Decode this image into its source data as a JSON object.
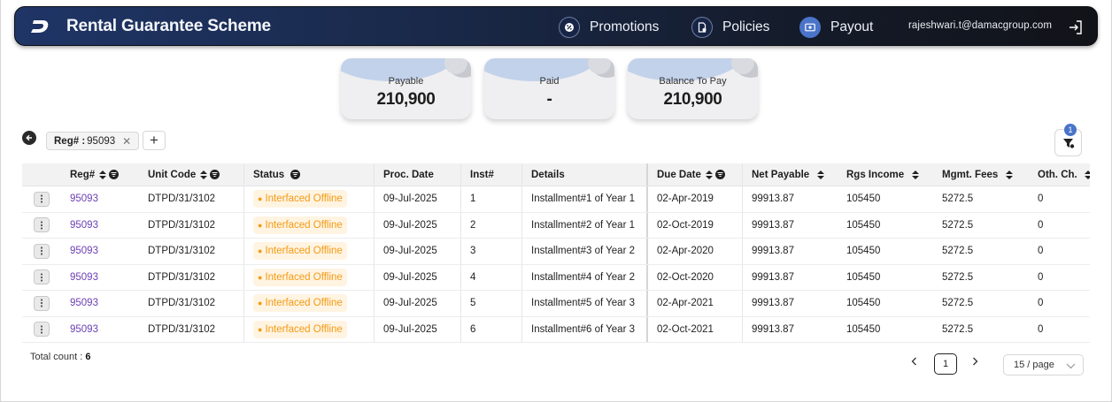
{
  "header": {
    "title": "Rental Guarantee Scheme",
    "nav": [
      {
        "label": "Promotions",
        "icon": "promotion-icon",
        "active": false
      },
      {
        "label": "Policies",
        "icon": "policy-document-icon",
        "active": false
      },
      {
        "label": "Payout",
        "icon": "payout-icon",
        "active": true
      }
    ],
    "user_email": "rajeshwari.t@damacgroup.com"
  },
  "summary": [
    {
      "label": "Payable",
      "value": "210,900"
    },
    {
      "label": "Paid",
      "value": "-"
    },
    {
      "label": "Balance To Pay",
      "value": "210,900"
    }
  ],
  "filters": {
    "chip_key": "Reg# :",
    "chip_value": "95093",
    "active_filter_count": "1"
  },
  "table": {
    "columns": [
      {
        "label": "Reg#",
        "sortable": true,
        "filterable": true
      },
      {
        "label": "Unit Code",
        "sortable": true,
        "filterable": true
      },
      {
        "label": "Status",
        "sortable": false,
        "filterable": true
      },
      {
        "label": "Proc. Date",
        "sortable": false,
        "filterable": false
      },
      {
        "label": "Inst#",
        "sortable": false,
        "filterable": false
      },
      {
        "label": "Details",
        "sortable": false,
        "filterable": false
      },
      {
        "label": "Due Date",
        "sortable": true,
        "filterable": true
      },
      {
        "label": "Net Payable",
        "sortable": true,
        "filterable": false
      },
      {
        "label": "Rgs Income",
        "sortable": true,
        "filterable": false
      },
      {
        "label": "Mgmt. Fees",
        "sortable": true,
        "filterable": false
      },
      {
        "label": "Oth. Ch.",
        "sortable": true,
        "filterable": false
      }
    ],
    "rows": [
      {
        "reg": "95093",
        "unit": "DTPD/31/3102",
        "status": "Interfaced Offline",
        "proc": "09-Jul-2025",
        "inst": "1",
        "details": "Installment#1 of Year 1",
        "due": "02-Apr-2019",
        "net": "99913.87",
        "rgs": "105450",
        "mgmt": "5272.5",
        "oth": "0"
      },
      {
        "reg": "95093",
        "unit": "DTPD/31/3102",
        "status": "Interfaced Offline",
        "proc": "09-Jul-2025",
        "inst": "2",
        "details": "Installment#2 of Year 1",
        "due": "02-Oct-2019",
        "net": "99913.87",
        "rgs": "105450",
        "mgmt": "5272.5",
        "oth": "0"
      },
      {
        "reg": "95093",
        "unit": "DTPD/31/3102",
        "status": "Interfaced Offline",
        "proc": "09-Jul-2025",
        "inst": "3",
        "details": "Installment#3 of Year 2",
        "due": "02-Apr-2020",
        "net": "99913.87",
        "rgs": "105450",
        "mgmt": "5272.5",
        "oth": "0"
      },
      {
        "reg": "95093",
        "unit": "DTPD/31/3102",
        "status": "Interfaced Offline",
        "proc": "09-Jul-2025",
        "inst": "4",
        "details": "Installment#4 of Year 2",
        "due": "02-Oct-2020",
        "net": "99913.87",
        "rgs": "105450",
        "mgmt": "5272.5",
        "oth": "0"
      },
      {
        "reg": "95093",
        "unit": "DTPD/31/3102",
        "status": "Interfaced Offline",
        "proc": "09-Jul-2025",
        "inst": "5",
        "details": "Installment#5 of Year 3",
        "due": "02-Apr-2021",
        "net": "99913.87",
        "rgs": "105450",
        "mgmt": "5272.5",
        "oth": "0"
      },
      {
        "reg": "95093",
        "unit": "DTPD/31/3102",
        "status": "Interfaced Offline",
        "proc": "09-Jul-2025",
        "inst": "6",
        "details": "Installment#6 of Year 3",
        "due": "02-Oct-2021",
        "net": "99913.87",
        "rgs": "105450",
        "mgmt": "5272.5",
        "oth": "0"
      }
    ]
  },
  "footer": {
    "total_label": "Total count :",
    "total_value": "6",
    "current_page": "1",
    "page_size": "15 / page"
  },
  "colors": {
    "header_start": "#1f3566",
    "header_end": "#111318",
    "accent": "#4a74c9",
    "link": "#6b3fb5",
    "status_text": "#f49a14",
    "status_bg": "#fff4e2"
  }
}
